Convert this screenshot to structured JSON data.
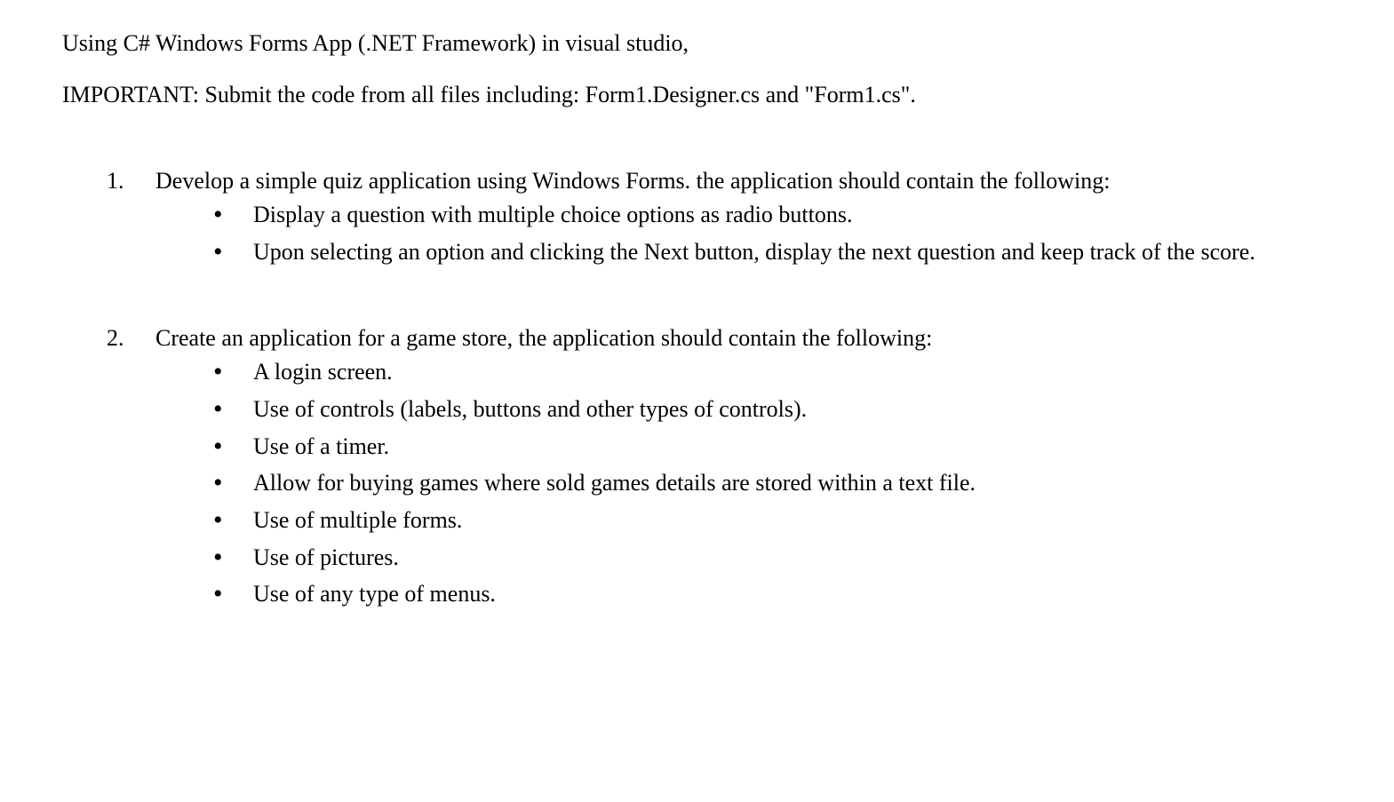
{
  "intro": "Using C# Windows Forms App (.NET Framework) in visual studio,",
  "important": "IMPORTANT: Submit the code from all files including: Form1.Designer.cs and \"Form1.cs\".",
  "items": [
    {
      "num": "1.",
      "text": "Develop a simple quiz application using Windows Forms. the application should contain the following:",
      "bullets": [
        "Display a question with multiple choice options as radio buttons.",
        "Upon selecting an option and clicking the Next button, display the next question and keep track of the score."
      ]
    },
    {
      "num": "2.",
      "text": "Create an application for a game store, the application should contain the following:",
      "bullets": [
        "A login screen.",
        "Use of controls (labels, buttons and other types of controls).",
        "Use of a timer.",
        "Allow for buying games where sold games details are stored within a text file.",
        "Use of multiple forms.",
        "Use of pictures.",
        "Use of any type of menus."
      ]
    }
  ]
}
